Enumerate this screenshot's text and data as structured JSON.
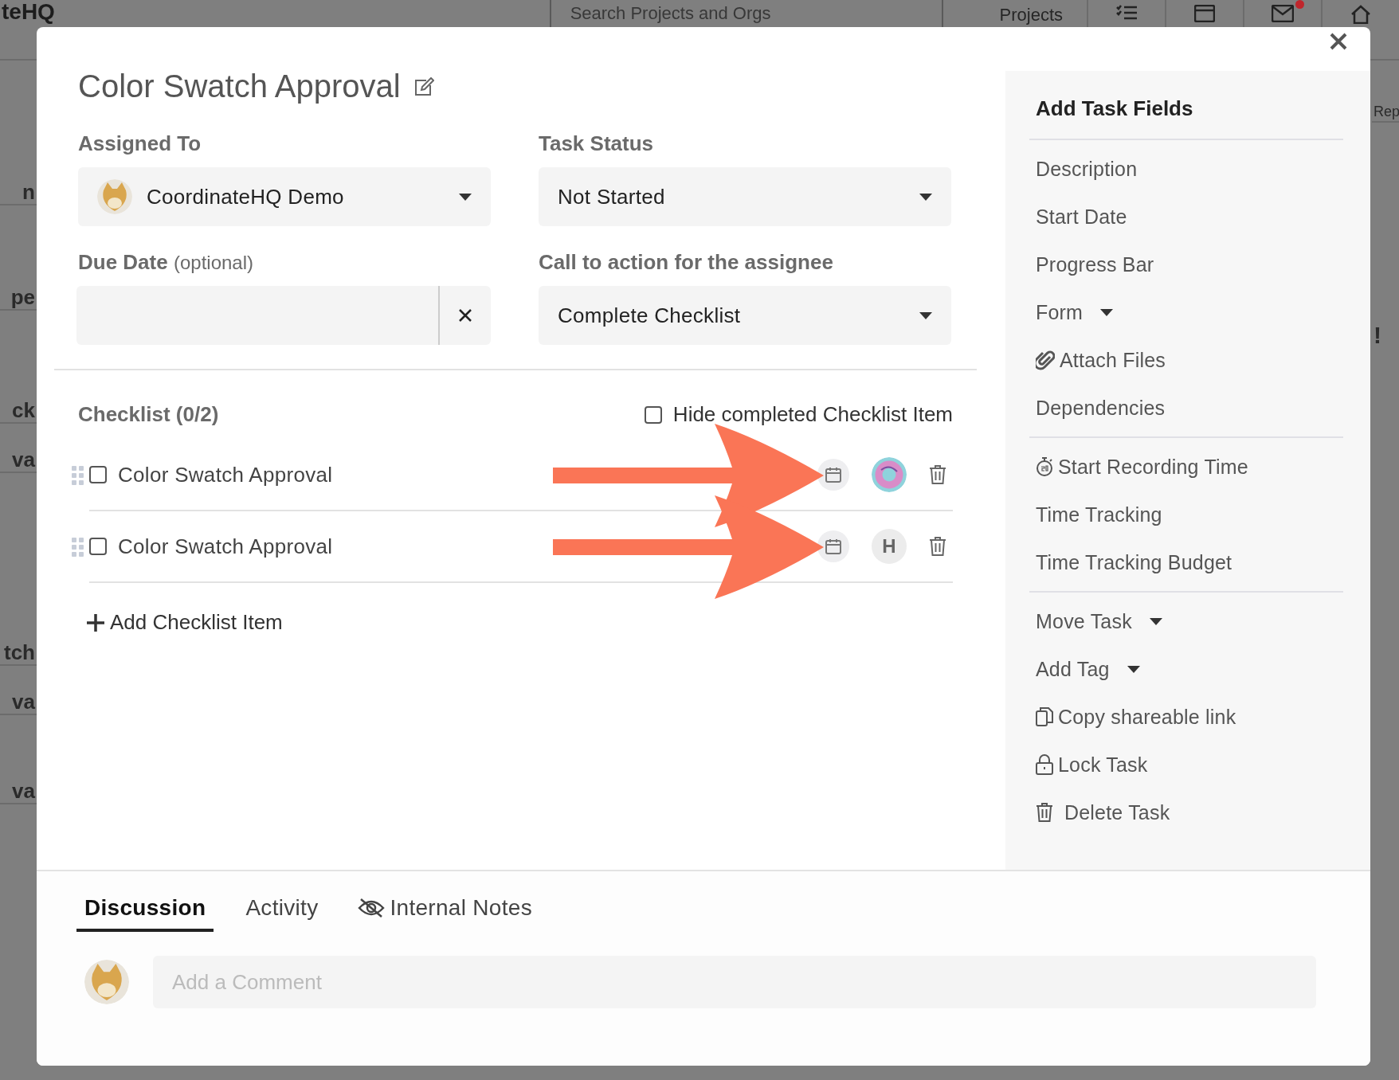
{
  "background": {
    "logo": "teHQ",
    "search": {
      "placeholder": "Search Projects and Orgs"
    },
    "nav_link": "Projects",
    "mail_unread": true,
    "left_fragments": [
      "n",
      "pe",
      "ck",
      "va",
      "tch",
      "va",
      "va"
    ],
    "right_fragments": [
      "Rep",
      "!"
    ]
  },
  "modal": {
    "title": "Color Swatch Approval",
    "fields": [
      {
        "label": "Assigned To",
        "kind": "user-select",
        "value": "CoordinateHQ Demo"
      },
      {
        "label": "Task Status",
        "kind": "select",
        "value": "Not Started"
      },
      {
        "label": "Due Date",
        "hint": "(optional)",
        "kind": "date"
      },
      {
        "label": "Call to action for the assignee",
        "kind": "select",
        "value": "Complete Checklist"
      }
    ],
    "checklist": {
      "title": "Checklist (0/2)",
      "hide_completed": {
        "label": "Hide completed Checklist Item",
        "checked": false
      },
      "items": [
        {
          "label": "Color Swatch Approval",
          "checked": false,
          "kind": "picture-assignee"
        },
        {
          "label": "Color Swatch Approval",
          "checked": false,
          "kind": "initial-assignee",
          "initial": "H"
        }
      ],
      "add_label": "Add Checklist Item"
    },
    "sidebar": {
      "title": "Add Task Fields",
      "groups": [
        [
          {
            "label": "Description",
            "kind": "plain",
            "dropdown": false
          },
          {
            "label": "Start Date",
            "kind": "plain",
            "dropdown": false
          },
          {
            "label": "Progress Bar",
            "kind": "plain",
            "dropdown": false
          },
          {
            "label": "Form",
            "kind": "plain",
            "dropdown": true
          },
          {
            "label": "Attach Files",
            "kind": "attach",
            "dropdown": false
          },
          {
            "label": "Dependencies",
            "kind": "plain",
            "dropdown": false
          }
        ],
        [
          {
            "label": "Start Recording Time",
            "kind": "timer",
            "dropdown": false
          },
          {
            "label": "Time Tracking",
            "kind": "plain",
            "dropdown": false
          },
          {
            "label": "Time Tracking Budget",
            "kind": "plain",
            "dropdown": false
          }
        ],
        [
          {
            "label": "Move Task",
            "kind": "plain",
            "dropdown": true
          },
          {
            "label": "Add Tag",
            "kind": "plain",
            "dropdown": true
          },
          {
            "label": "Copy shareable link",
            "kind": "copy",
            "dropdown": false
          },
          {
            "label": "Lock Task",
            "kind": "lock",
            "dropdown": false
          },
          {
            "label": "Delete Task",
            "kind": "delete",
            "dropdown": false
          }
        ]
      ]
    },
    "tabs": [
      {
        "label": "Discussion",
        "selected": true,
        "kind": "plain"
      },
      {
        "label": "Activity",
        "selected": false,
        "kind": "plain"
      },
      {
        "label": "Internal Notes",
        "selected": false,
        "kind": "hidden"
      }
    ],
    "comment": {
      "placeholder": "Add a Comment"
    }
  }
}
